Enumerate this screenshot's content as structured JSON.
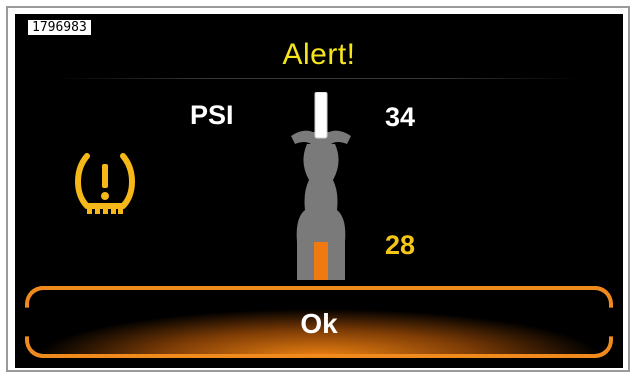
{
  "image_id_label": "1796983",
  "alert": {
    "title": "Alert!",
    "title_color": "#f5e51c",
    "icon": "tire-pressure-warning-icon",
    "icon_color": "#f5b818"
  },
  "pressure": {
    "unit": "PSI",
    "front_value": "34",
    "front_color": "#ffffff",
    "rear_value": "28",
    "rear_color": "#f5c518",
    "front_status": "normal",
    "rear_status": "low",
    "rear_indicator_color": "#f07a10"
  },
  "ok_button": {
    "label": "Ok",
    "accent_color": "#f08a1c"
  }
}
